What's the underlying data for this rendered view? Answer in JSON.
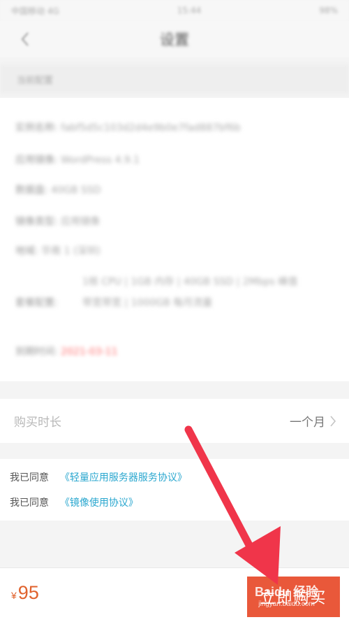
{
  "status_bar": {
    "carrier": "中国移动 4G",
    "time": "15:44",
    "battery": "98%"
  },
  "nav": {
    "title": "设置"
  },
  "section_header": {
    "label": "当前配置"
  },
  "config": {
    "rows": [
      {
        "label": "实例名称:",
        "value": "fabf5d5c103d2d4e9b0e7fad887bf6b"
      },
      {
        "label": "应用镜像:",
        "value": "WordPress 4.9.1"
      },
      {
        "label": "数据盘:",
        "value": "40GB SSD"
      },
      {
        "label": "镜像类型:",
        "value": "应用镜像"
      },
      {
        "label": "地域:",
        "value": "华南 1 (深圳)"
      }
    ],
    "package_label": "套餐配置:",
    "package_value": "1核 CPU | 1GB 内存 | 40GB SSD | 2Mbps 峰值带宽带宽 | 1000GB 每月流量",
    "expire_label": "到期时间:",
    "expire_value": "2021-03-11",
    "expire_color": "#ff6b6b"
  },
  "duration": {
    "label": "购买时长",
    "value": "一个月"
  },
  "agreements": [
    {
      "prefix": "我已同意",
      "link": "《轻量应用服务器服务协议》"
    },
    {
      "prefix": "我已同意",
      "link": "《镜像使用协议》"
    }
  ],
  "bottom": {
    "currency": "¥",
    "price": "95",
    "buy_label": "立即购买"
  },
  "watermark": {
    "main": "Baidu 经验",
    "sub": "jingyan.baidu.com"
  },
  "colors": {
    "accent": "#e9583a",
    "price": "#e0622d",
    "link": "#2aa7cf",
    "arrow": "#f0354a"
  }
}
